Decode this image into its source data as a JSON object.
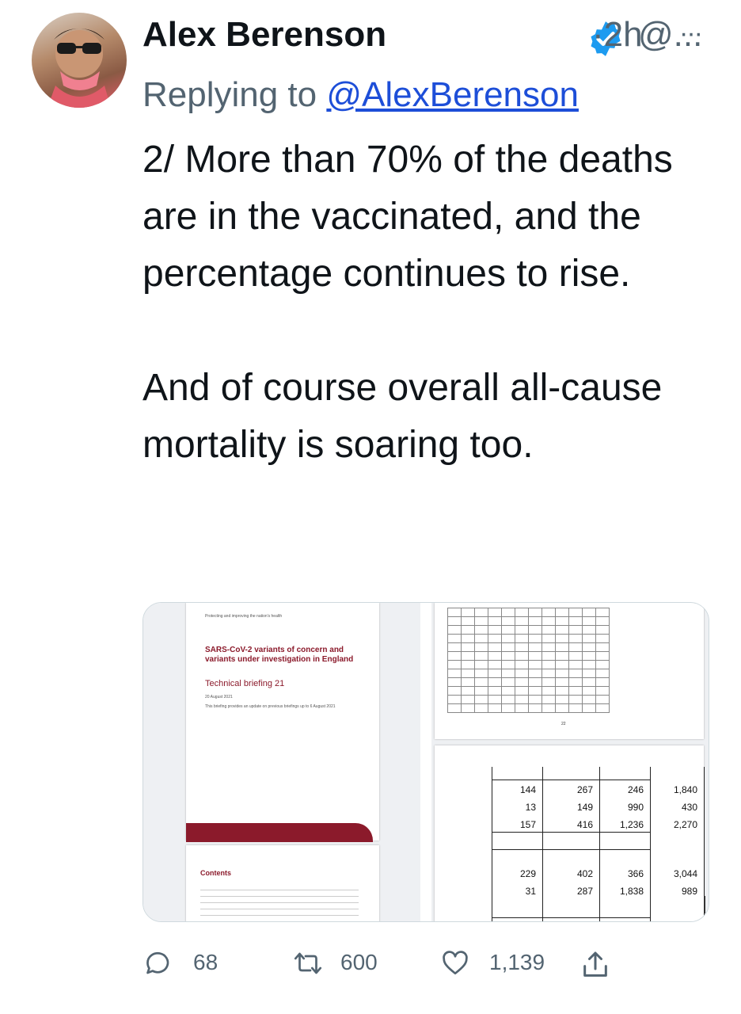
{
  "tweet": {
    "author_name": "Alex Berenson",
    "handle": "@...",
    "time": "·2h",
    "more": "···",
    "replying_prefix": "Replying to ",
    "replying_to": "@AlexBerenson",
    "paragraphs": [
      "2/ More than 70% of the deaths are in the vaccinated, and the percentage continues to rise.",
      "And of course overall all-cause mortality is soaring too."
    ]
  },
  "media": {
    "doc_header": "Protecting and improving the nation's health",
    "doc_title": "SARS-CoV-2 variants of concern and variants under investigation in England",
    "doc_subtitle": "Technical briefing 21",
    "doc_date": "20 August 2021",
    "doc_note": "This briefing provides an update on previous briefings up to 6 August 2021",
    "contents_label": "Contents",
    "page_number": "22",
    "table_rows": [
      [
        "144",
        "267",
        "246",
        "1,840"
      ],
      [
        "13",
        "149",
        "990",
        "430"
      ],
      [
        "157",
        "416",
        "1,236",
        "2,270"
      ],
      [
        "229",
        "402",
        "366",
        "3,044"
      ],
      [
        "31",
        "287",
        "1,838",
        "989"
      ]
    ]
  },
  "actions": {
    "replies": "68",
    "retweets": "600",
    "likes": "1,139"
  },
  "colors": {
    "link": "#1d4ed8",
    "secondary_text": "#536471",
    "verified": "#1d9bf0",
    "doc_red": "#8b1a2b"
  }
}
